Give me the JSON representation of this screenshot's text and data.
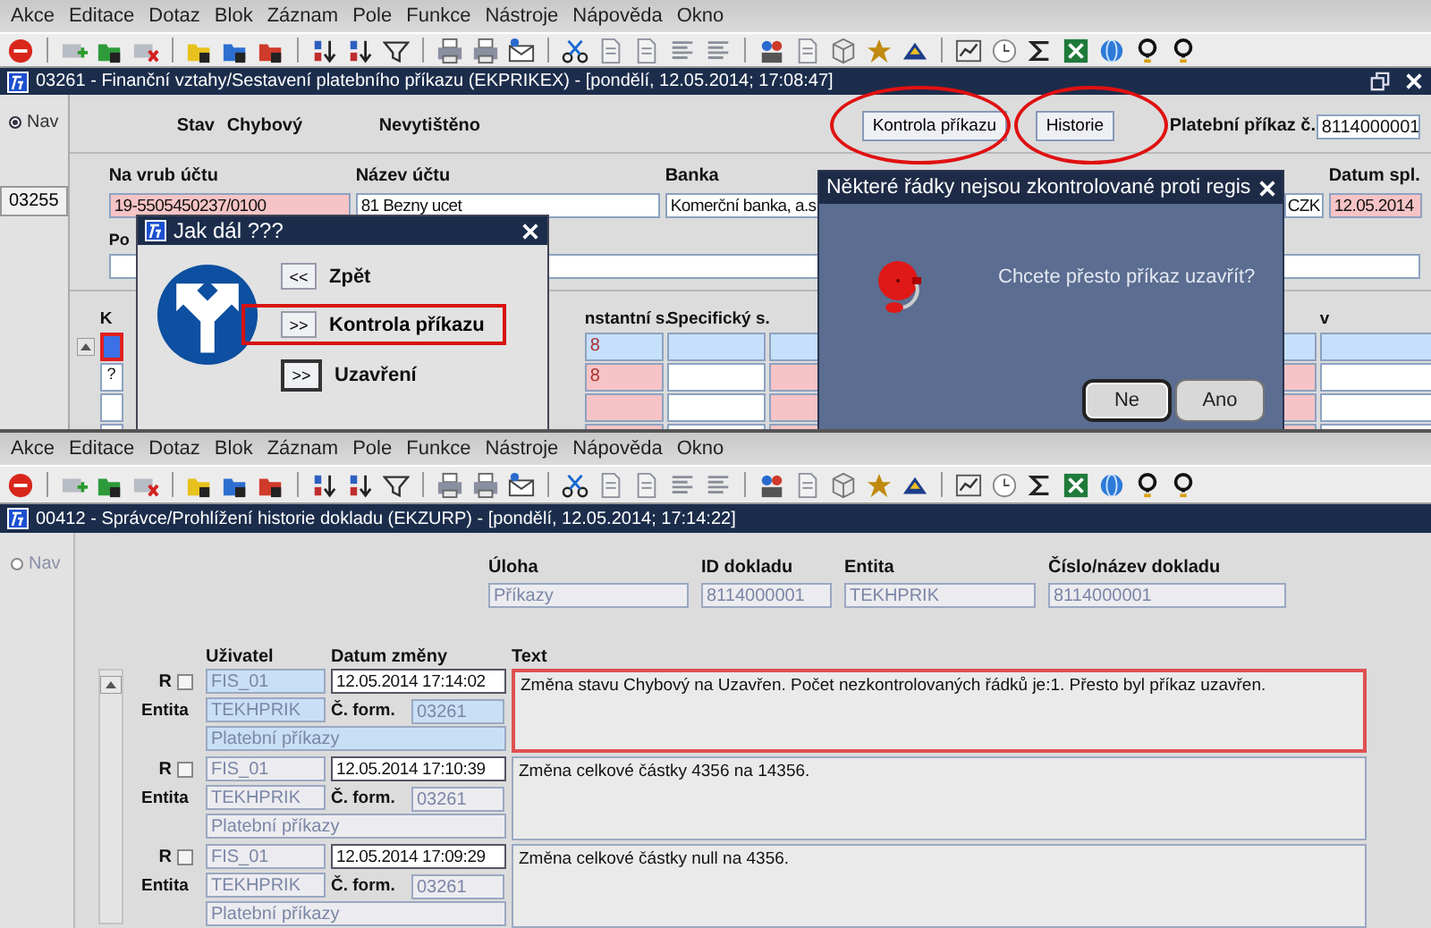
{
  "payment_order_screen": {
    "menu": [
      "Akce",
      "Editace",
      "Dotaz",
      "Blok",
      "Záznam",
      "Pole",
      "Funkce",
      "Nástroje",
      "Nápověda",
      "Okno"
    ],
    "window_title": "03261 - Finanční vztahy/Sestavení platebního příkazu (EKPRIKEX) - [pondělí, 12.05.2014; 17:08:47]",
    "nav": {
      "label": "Nav",
      "selected": true
    },
    "nav_button": "03255",
    "status_label": "Stav",
    "status_value": "Chybový",
    "print_state": "Nevytištěno",
    "buttons": [
      {
        "label": "Kontrola příkazu",
        "highlighted": true
      },
      {
        "label": "Historie",
        "highlighted": true
      }
    ],
    "order_number": {
      "label": "Platební příkaz č.",
      "value": "8114000001"
    },
    "fields": [
      {
        "label": "Na vrub účtu",
        "value": "19-5505450237/0100",
        "invalid": true
      },
      {
        "label": "Název účtu",
        "value": "81 Bezny ucet",
        "invalid": false
      },
      {
        "label": "Banka",
        "value": "Komerční banka, a.s",
        "invalid": false
      },
      {
        "value": "CZK",
        "invalid": false
      },
      {
        "label": "Datum spl.",
        "value": "12.05.2014",
        "invalid": true
      }
    ],
    "note_label": "Po",
    "table": {
      "columns": [
        {
          "label": "K",
          "required": false
        },
        {
          "label": "nstantní s.",
          "required": true
        },
        {
          "label": "Specifický s.",
          "required": false
        },
        {
          "required": true
        },
        {
          "label": "v",
          "required": false
        }
      ],
      "rows": [
        {
          "selected": true,
          "column_2": "8"
        },
        {
          "selected": false,
          "k": "?",
          "column_2": "8"
        },
        {
          "selected": false
        },
        {
          "selected": false
        }
      ]
    },
    "next_step_dialog": {
      "title": "Jak dál ???",
      "options": [
        {
          "key": "<<",
          "label": "Zpět",
          "highlighted": false,
          "focused": false
        },
        {
          "key": ">>",
          "label": "Kontrola příkazu",
          "highlighted": true,
          "focused": false
        },
        {
          "key": ">>",
          "label": "Uzavření",
          "highlighted": false,
          "focused": true
        }
      ]
    },
    "message_dialog": {
      "title": "Některé řádky nejsou zkontrolované proti regis",
      "message": "Chcete přesto příkaz uzavřít?",
      "buttons": [
        {
          "label": "Ne",
          "selected": true
        },
        {
          "label": "Ano",
          "selected": false
        }
      ]
    }
  },
  "history_screen": {
    "menu": [
      "Akce",
      "Editace",
      "Dotaz",
      "Blok",
      "Záznam",
      "Pole",
      "Funkce",
      "Nástroje",
      "Nápověda",
      "Okno"
    ],
    "window_title": "00412 - Správce/Prohlížení historie dokladu (EKZURP) - [pondělí, 12.05.2014; 17:14:22]",
    "nav": {
      "label": "Nav",
      "selected": false
    },
    "header_fields": [
      {
        "label": "Úloha",
        "value": "Příkazy"
      },
      {
        "label": "ID dokladu",
        "value": "8114000001"
      },
      {
        "label": "Entita",
        "value": "TEKHPRIK"
      },
      {
        "label": "Číslo/název dokladu",
        "value": "8114000001"
      }
    ],
    "columns": [
      "Uživatel",
      "Datum změny",
      "Text"
    ],
    "records": [
      {
        "selected": true,
        "r_label": "R",
        "checked": false,
        "user": "FIS_01",
        "date": "12.05.2014 17:14:02",
        "entity_label": "Entita",
        "entity": "TEKHPRIK",
        "form_label": "Č. form.",
        "form": "03261",
        "entity_name": "Platební příkazy",
        "text": "Změna stavu Chybový na Uzavřen. Počet nezkontrolovaných řádků je:1. Přesto byl příkaz uzavřen."
      },
      {
        "selected": false,
        "r_label": "R",
        "checked": false,
        "user": "FIS_01",
        "date": "12.05.2014 17:10:39",
        "entity_label": "Entita",
        "entity": "TEKHPRIK",
        "form_label": "Č. form.",
        "form": "03261",
        "entity_name": "Platební příkazy",
        "text": "Změna celkové částky 4356 na 14356."
      },
      {
        "selected": false,
        "r_label": "R",
        "checked": false,
        "user": "FIS_01",
        "date": "12.05.2014 17:09:29",
        "entity_label": "Entita",
        "entity": "TEKHPRIK",
        "form_label": "Č. form.",
        "form": "03261",
        "entity_name": "Platební příkazy",
        "text": "Změna celkové částky null na 4356."
      }
    ]
  }
}
